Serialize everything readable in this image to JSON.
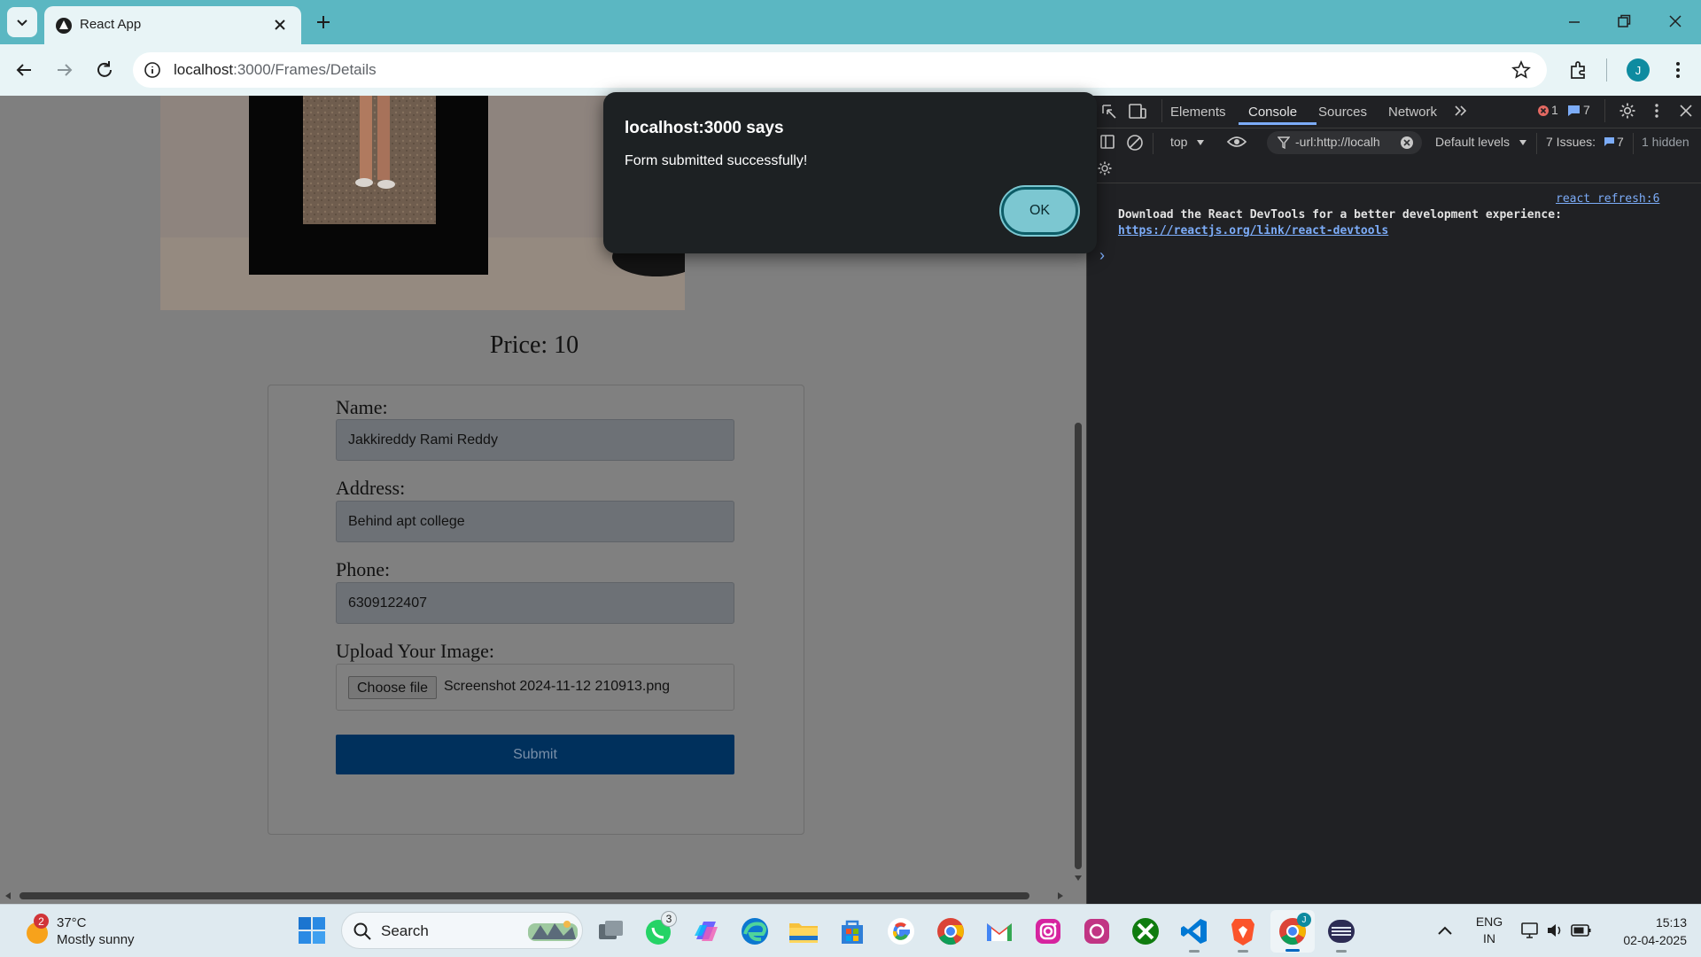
{
  "browser": {
    "tab_title": "React App",
    "url_host": "localhost",
    "url_path": ":3000/Frames/Details",
    "profile_initial": "J"
  },
  "page": {
    "price_text": "Price: 10",
    "form": {
      "name_label": "Name:",
      "name_value": "Jakkireddy Rami Reddy",
      "address_label": "Address:",
      "address_value": "Behind apt college",
      "phone_label": "Phone:",
      "phone_value": "6309122407",
      "upload_label": "Upload Your Image:",
      "choose_file_label": "Choose file",
      "file_name": "Screenshot 2024-11-12 210913.png",
      "submit_label": "Submit"
    }
  },
  "dialog": {
    "title": "localhost:3000 says",
    "message": "Form submitted successfully!",
    "ok_label": "OK"
  },
  "devtools": {
    "tabs": [
      "Elements",
      "Console",
      "Sources",
      "Network"
    ],
    "active_tab": "Console",
    "error_count": "1",
    "message_count": "7",
    "context": "top",
    "filter_value": "-url:http://localh",
    "levels": "Default levels",
    "issues_label": "7 Issues:",
    "issues_count": "7",
    "hidden_label": "1 hidden",
    "log_source": "react refresh:6",
    "log_message": "Download the React DevTools for a better experience:",
    "log_message_full": "Download the React DevTools for a better development experience:",
    "log_link": "https://reactjs.org/link/react-devtools",
    "prompt": "›"
  },
  "taskbar": {
    "weather_badge": "2",
    "temperature": "37°C",
    "weather_desc": "Mostly sunny",
    "search_label": "Search",
    "whatsapp_badge": "3",
    "chrome_badge": "J",
    "lang_line1": "ENG",
    "lang_line2": "IN",
    "time": "15:13",
    "date": "02-04-2025"
  },
  "colors": {
    "titlebar": "#5bb7c2",
    "dialog_ok": "#7cc7d1",
    "devtools_accent": "#7cacf8",
    "submit_bg": "#00305c"
  }
}
